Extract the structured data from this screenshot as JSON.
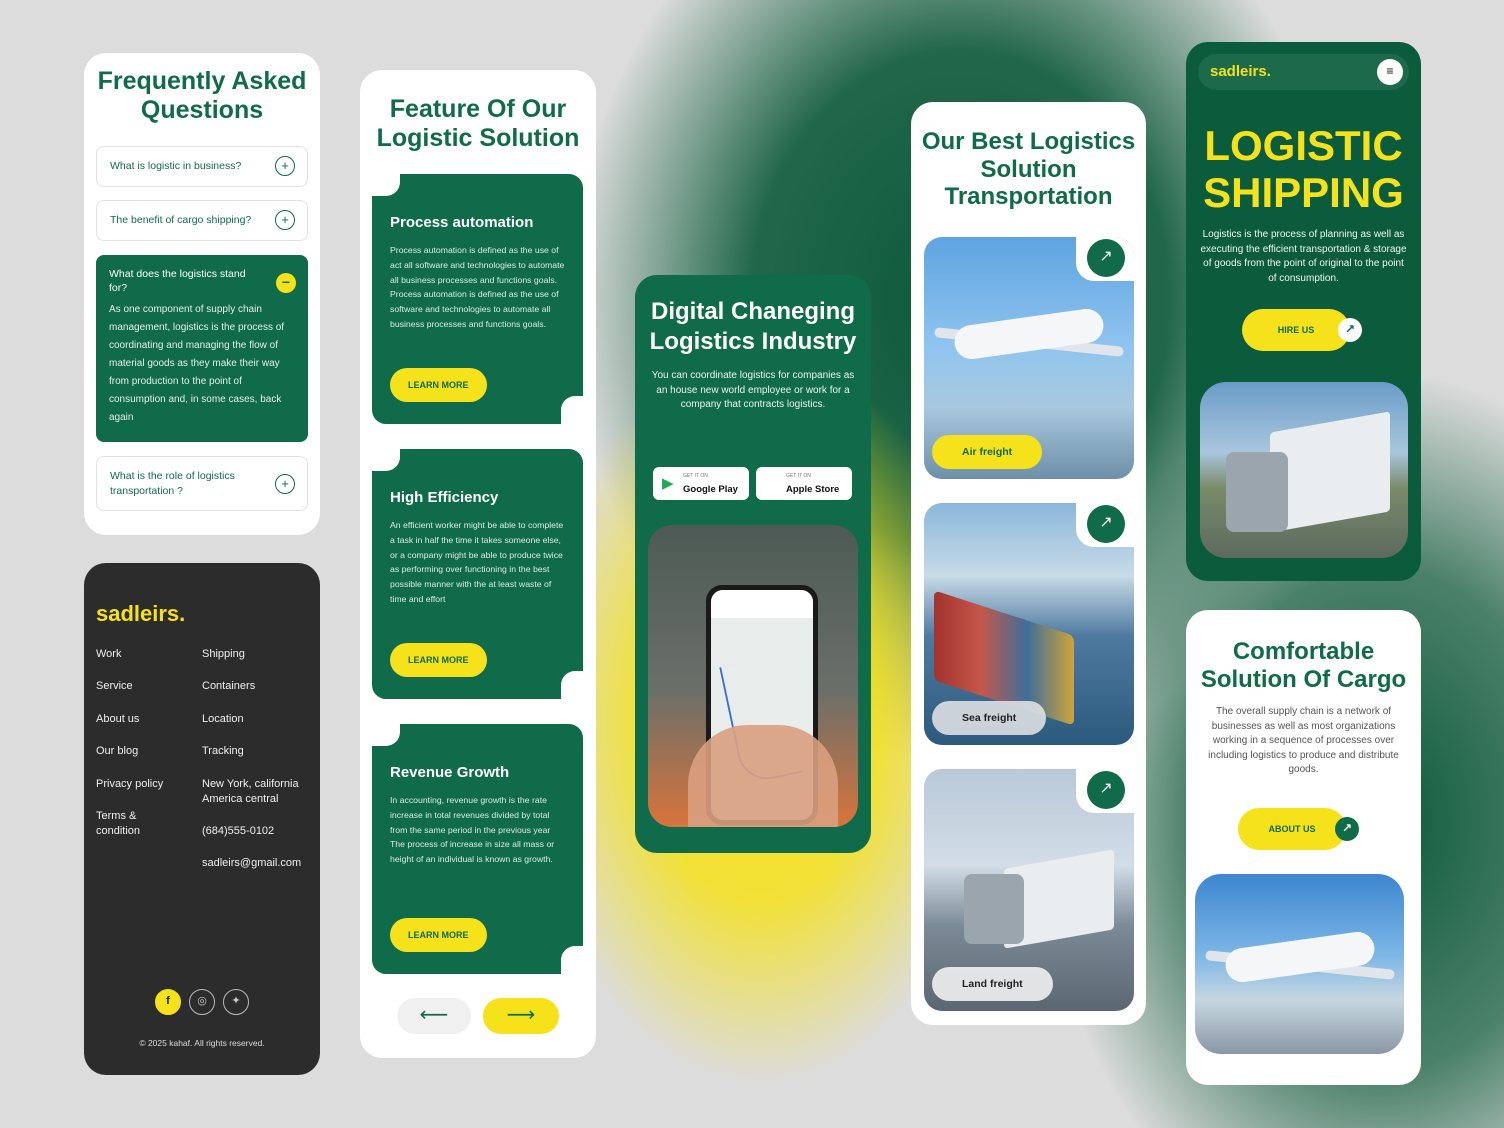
{
  "faq": {
    "title": "Frequently Asked Questions",
    "items": [
      {
        "question": "What is logistic in business?"
      },
      {
        "question": "The benefit of cargo shipping?"
      },
      {
        "question": "What does the logistics stand for?",
        "answer": "As one component of supply chain management, logistics is the process of coordinating and managing the flow of material goods as they make their way from production to the point of consumption and, in some cases, back again"
      },
      {
        "question": "What is the role of logistics transportation ?"
      }
    ]
  },
  "footer": {
    "logo": "sadleirs.",
    "col1": [
      "Work",
      "Service",
      "About us",
      "Our blog",
      "Privacy policy",
      "Terms & condition"
    ],
    "col2": [
      "Shipping",
      "Containers",
      "Location",
      "Tracking",
      "New York, california America central",
      "(684)555-0102",
      "sadleirs@gmail.com"
    ],
    "social": [
      "f",
      "◎",
      "✦"
    ],
    "copyright": "© 2025 kahaf. All rights reserved."
  },
  "features": {
    "title": "Feature Of Our Logistic Solution",
    "cards": [
      {
        "title": "Process automation",
        "text": "Process automation is defined as the use of act all software and technologies to automate all business processes and functions goals. Process automation is defined as the use of software and technologies to automate all business processes and functions goals.",
        "button": "LEARN MORE"
      },
      {
        "title": "High Efficiency",
        "text": "An efficient worker might be able to complete a task in half the time it takes someone else, or a company might be able to produce twice as performing over functioning in the best possible manner with the at least waste of time and effort",
        "button": "LEARN MORE"
      },
      {
        "title": "Revenue Growth",
        "text": "In accounting, revenue growth is the rate increase in total revenues divided by total from the same period in the previous year The process of increase in size all mass or height of an individual is known as growth.",
        "button": "LEARN MORE"
      }
    ],
    "prev": "⟵",
    "next": "⟶"
  },
  "digital": {
    "title": "Digital Chaneging Logistics Industry",
    "subtitle": "You can coordinate logistics for companies as an house new world employee or work for a company that contracts logistics.",
    "stores": [
      {
        "small": "GET IT ON",
        "name": "Google Play",
        "icon": "▶"
      },
      {
        "small": "GET IT ON",
        "name": "Apple Store",
        "icon": ""
      }
    ]
  },
  "best": {
    "title": "Our Best Logistics Solution Transportation",
    "tiles": [
      {
        "label": "Air freight",
        "arrow": "↗"
      },
      {
        "label": "Sea freight",
        "arrow": "↗"
      },
      {
        "label": "Land freight",
        "arrow": "↗"
      }
    ]
  },
  "hero": {
    "logo": "sadleirs.",
    "menu_icon": "≡",
    "title": "LOGISTIC SHIPPING",
    "description": "Logistics is the process of planning as well as executing the efficient transportation & storage of goods from the point of original to the point of consumption.",
    "button": "HIRE US",
    "arrow": "↗"
  },
  "comfort": {
    "title": "Comfortable Solution Of Cargo",
    "description": "The overall supply chain is a network of businesses as well as most organizations working in a sequence of processes over including logistics to produce and distribute goods.",
    "button": "ABOUT US",
    "arrow": "↗"
  },
  "colors": {
    "green": "#0f6b4a",
    "yellow": "#f5e21a",
    "dark": "#2c2c2c"
  }
}
